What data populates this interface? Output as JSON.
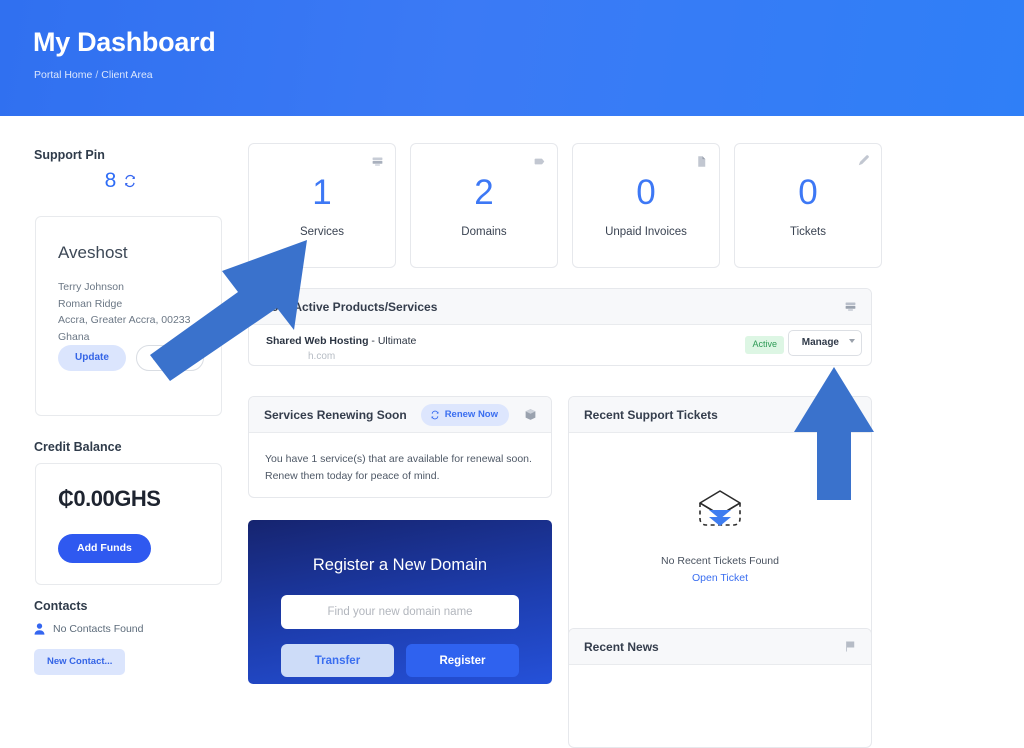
{
  "header": {
    "title": "My Dashboard",
    "breadcrumb": {
      "home": "Portal Home",
      "separator": "/",
      "current": "Client Area"
    },
    "gradient_from": "#3070f0",
    "gradient_to": "#2f7ff7"
  },
  "sidebar": {
    "support_pin": {
      "heading": "Support Pin",
      "value": "8",
      "refresh_icon": "refresh-icon"
    },
    "profile": {
      "name": "Aveshost",
      "address_lines": [
        "Terry Johnson",
        "Roman Ridge",
        "Accra, Greater Accra, 00233",
        "Ghana"
      ],
      "update_label": "Update",
      "logout_label": "Logout"
    },
    "credit": {
      "heading": "Credit Balance",
      "amount": "₵0.00GHS",
      "add_funds_label": "Add Funds"
    },
    "contacts": {
      "heading": "Contacts",
      "empty_text": "No Contacts Found",
      "new_contact_label": "New Contact...",
      "person_icon": "person-icon"
    }
  },
  "main": {
    "stats": [
      {
        "value": "1",
        "label": "Services",
        "icon": "server-icon"
      },
      {
        "value": "2",
        "label": "Domains",
        "icon": "tag-icon"
      },
      {
        "value": "0",
        "label": "Unpaid Invoices",
        "icon": "document-icon"
      },
      {
        "value": "0",
        "label": "Tickets",
        "icon": "ticket-icon"
      }
    ],
    "stat_number_color": "#3d78f5",
    "products": {
      "title": "Your Active Products/Services",
      "head_icon": "server-icon",
      "rows": [
        {
          "product": "Shared Web Hosting",
          "plan": "- Ultimate",
          "domain": "h.com",
          "status": "Active",
          "status_color": "#2e9b56",
          "manage_label": "Manage"
        }
      ]
    },
    "renewing": {
      "title": "Services Renewing Soon",
      "renew_label": "Renew Now",
      "renew_icon": "refresh-icon",
      "head_icon": "box-icon",
      "body": "You have 1 service(s) that are available for renewal soon. Renew them today for peace of mind."
    },
    "domain_box": {
      "title": "Register a New Domain",
      "placeholder": "Find your new domain name",
      "search_value": "",
      "transfer_label": "Transfer",
      "register_label": "Register"
    },
    "tickets": {
      "title": "Recent Support Tickets",
      "head_icon": "ticket-icon",
      "empty_text": "No Recent Tickets Found",
      "open_ticket_label": "Open Ticket",
      "empty_icon": "empty-inbox-icon"
    },
    "news": {
      "title": "Recent News",
      "head_icon": "flag-icon"
    }
  },
  "annotations": {
    "arrow_color": "#3a72cc",
    "arrows": [
      {
        "name": "arrow-pointing-to-services-card",
        "target": "Services"
      },
      {
        "name": "arrow-pointing-to-manage-button",
        "target": "Manage"
      }
    ]
  }
}
